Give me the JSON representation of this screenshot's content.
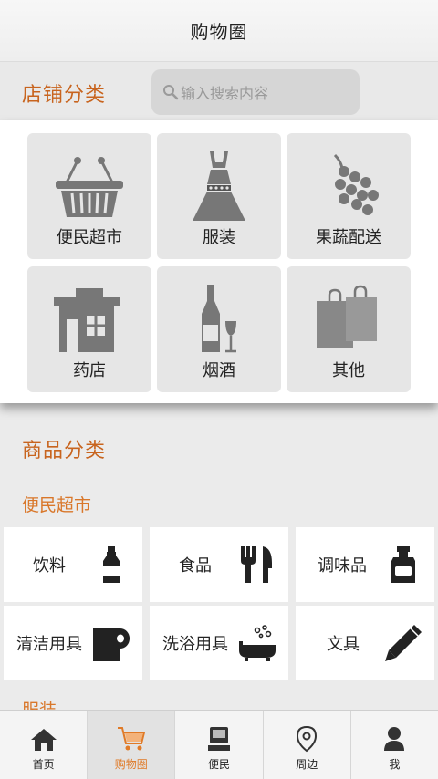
{
  "header": {
    "title": "购物圈"
  },
  "store_section": {
    "title": "店铺分类",
    "search_placeholder": "输入搜索内容",
    "categories": [
      {
        "label": "便民超市",
        "icon": "basket-icon"
      },
      {
        "label": "服装",
        "icon": "dress-icon"
      },
      {
        "label": "果蔬配送",
        "icon": "grapes-icon"
      },
      {
        "label": "药店",
        "icon": "building-icon"
      },
      {
        "label": "烟酒",
        "icon": "wine-icon"
      },
      {
        "label": "其他",
        "icon": "shopping-bags-icon"
      }
    ]
  },
  "goods_section": {
    "title": "商品分类",
    "subcategory": "便民超市",
    "next_subcategory": "服装",
    "items": [
      {
        "label": "饮料",
        "icon": "bottle-icon"
      },
      {
        "label": "食品",
        "icon": "fork-knife-icon"
      },
      {
        "label": "调味品",
        "icon": "sauce-jar-icon"
      },
      {
        "label": "清洁用具",
        "icon": "tissue-roll-icon"
      },
      {
        "label": "洗浴用具",
        "icon": "bathtub-icon"
      },
      {
        "label": "文具",
        "icon": "pen-icon"
      }
    ]
  },
  "tabbar": {
    "active": "购物圈",
    "accent_color": "#e07a27",
    "tabs": [
      {
        "label": "首页",
        "icon": "home-icon"
      },
      {
        "label": "购物圈",
        "icon": "cart-icon"
      },
      {
        "label": "便民",
        "icon": "service-icon"
      },
      {
        "label": "周边",
        "icon": "location-pin-icon"
      },
      {
        "label": "我",
        "icon": "user-icon"
      }
    ]
  }
}
